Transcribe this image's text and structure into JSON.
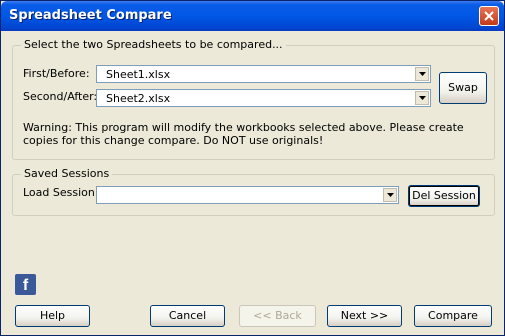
{
  "window": {
    "title": "Spreadsheet Compare"
  },
  "compare_group": {
    "legend": "Select the two Spreadsheets to be compared...",
    "first_label": "First/Before:",
    "first_value": "Sheet1.xlsx",
    "second_label": "Second/After:",
    "second_value": "Sheet2.xlsx",
    "swap_label": "Swap",
    "warning": "Warning: This program will modify the workbooks selected above. Please create copies for this change compare. Do NOT use originals!"
  },
  "sessions_group": {
    "legend": "Saved Sessions",
    "load_label": "Load Session:",
    "load_value": "",
    "delete_label": "Del Session"
  },
  "footer": {
    "facebook_glyph": "f",
    "help_label": "Help",
    "cancel_label": "Cancel",
    "back_label": "<< Back",
    "next_label": "Next >>",
    "compare_label": "Compare"
  }
}
